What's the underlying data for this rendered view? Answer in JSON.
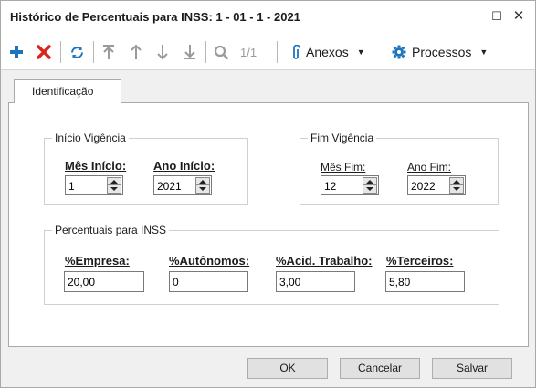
{
  "window": {
    "title": "Histórico de Percentuais para INSS: 1 - 01 - 1 - 2021",
    "maximize_glyph": "☐",
    "close_glyph": "✕"
  },
  "toolbar": {
    "page_indicator": "1/1",
    "attachments_label": "Anexos",
    "processes_label": "Processos",
    "icons": [
      "plus-icon",
      "delete-x-icon",
      "refresh-icon",
      "first-record-icon",
      "previous-record-icon",
      "next-record-icon",
      "last-record-icon",
      "search-icon",
      "paperclip-icon",
      "gear-icon"
    ],
    "colors": {
      "add": "#1e73be",
      "delete": "#d9261c",
      "refresh": "#1e73be",
      "nav_disabled": "#9a9a9a",
      "accent": "#1e73be"
    }
  },
  "tabs": [
    {
      "label": "Identificação"
    }
  ],
  "start_group": {
    "title": "Início Vigência",
    "month_label": "Mês Início:",
    "month_value": "1",
    "year_label": "Ano Início:",
    "year_value": "2021"
  },
  "end_group": {
    "title": "Fim Vigência",
    "month_label": "Mês Fim:",
    "month_value": "12",
    "year_label": "Ano Fim:",
    "year_value": "2022"
  },
  "percent_group": {
    "title": "Percentuais para INSS",
    "company_label": "%Empresa:",
    "company_value": "20,00",
    "autonomous_label": "%Autônomos:",
    "autonomous_value": "0",
    "accident_label": "%Acid. Trabalho:",
    "accident_value": "3,00",
    "third_label": "%Terceiros:",
    "third_value": "5,80"
  },
  "buttons": {
    "ok": "OK",
    "cancel": "Cancelar",
    "save": "Salvar"
  }
}
